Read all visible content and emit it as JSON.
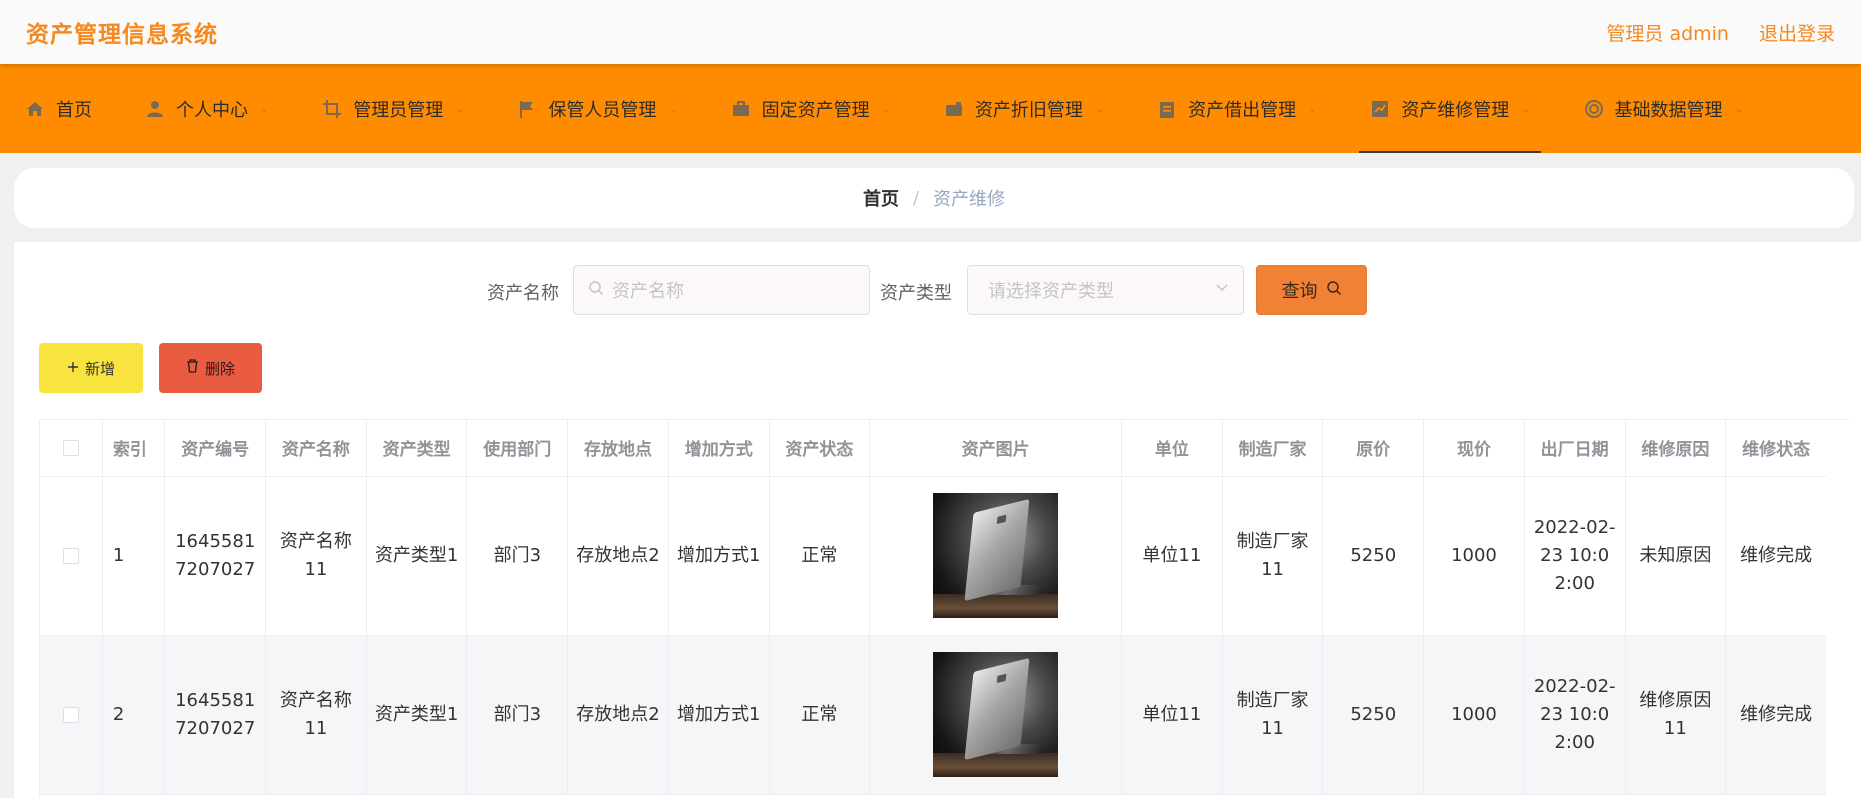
{
  "header": {
    "app_title": "资产管理信息系统",
    "user_label": "管理员 admin",
    "logout_label": "退出登录"
  },
  "nav": {
    "items": [
      {
        "label": "首页",
        "icon": "home-icon"
      },
      {
        "label": "个人中心",
        "icon": "user-icon"
      },
      {
        "label": "管理员管理",
        "icon": "crop-icon"
      },
      {
        "label": "保管人员管理",
        "icon": "flag-icon"
      },
      {
        "label": "固定资产管理",
        "icon": "briefcase-icon"
      },
      {
        "label": "资产折旧管理",
        "icon": "wallet-icon"
      },
      {
        "label": "资产借出管理",
        "icon": "clipboard-icon"
      },
      {
        "label": "资产维修管理",
        "icon": "chart-icon"
      },
      {
        "label": "基础数据管理",
        "icon": "circle-icon"
      }
    ],
    "active_index": 7
  },
  "breadcrumb": {
    "home": "首页",
    "separator": "/",
    "current": "资产维修"
  },
  "search": {
    "name_label": "资产名称",
    "name_placeholder": "资产名称",
    "type_label": "资产类型",
    "type_placeholder": "请选择资产类型",
    "query_label": "查询"
  },
  "actions": {
    "add_label": "新增",
    "delete_label": "删除"
  },
  "table": {
    "columns": [
      "索引",
      "资产编号",
      "资产名称",
      "资产类型",
      "使用部门",
      "存放地点",
      "增加方式",
      "资产状态",
      "资产图片",
      "单位",
      "制造厂家",
      "原价",
      "现价",
      "出厂日期",
      "维修原因",
      "维修状态"
    ],
    "rows": [
      {
        "index": "1",
        "code": "16455817207027",
        "name": "资产名称11",
        "type": "资产类型1",
        "dept": "部门3",
        "location": "存放地点2",
        "add_method": "增加方式1",
        "status": "正常",
        "unit": "单位11",
        "maker": "制造厂家11",
        "orig_price": "5250",
        "cur_price": "1000",
        "date": "2022-02-23 10:02:00",
        "reason": "未知原因",
        "repair_status": "维修完成"
      },
      {
        "index": "2",
        "code": "16455817207027",
        "name": "资产名称11",
        "type": "资产类型1",
        "dept": "部门3",
        "location": "存放地点2",
        "add_method": "增加方式1",
        "status": "正常",
        "unit": "单位11",
        "maker": "制造厂家11",
        "orig_price": "5250",
        "cur_price": "1000",
        "date": "2022-02-23 10:02:00",
        "reason": "维修原因11",
        "repair_status": "维修完成"
      }
    ]
  },
  "colors": {
    "accent": "#ff8c00",
    "title": "#f5891e",
    "query_button": "#f08135",
    "add_button": "#f9e43f",
    "delete_button": "#e95c42"
  }
}
